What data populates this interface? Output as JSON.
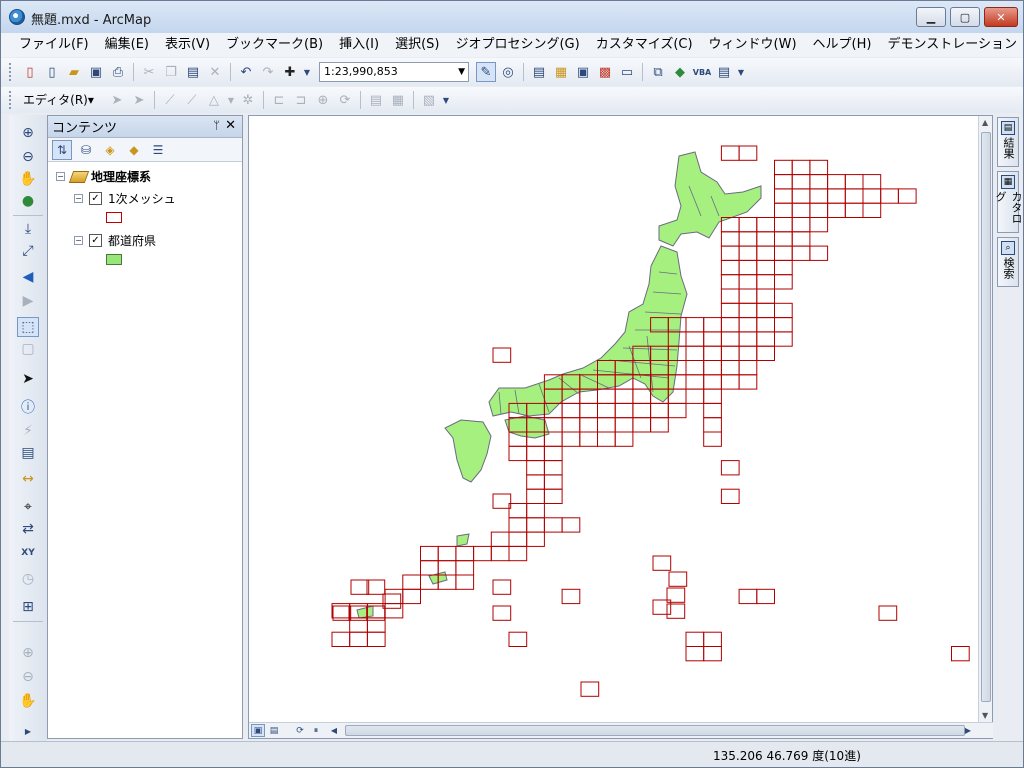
{
  "window": {
    "title": "無題.mxd - ArcMap",
    "min_label": "▁",
    "max_label": "▢",
    "close_label": "✕"
  },
  "menu": [
    {
      "label": "ファイル(F)"
    },
    {
      "label": "編集(E)"
    },
    {
      "label": "表示(V)"
    },
    {
      "label": "ブックマーク(B)"
    },
    {
      "label": "挿入(I)"
    },
    {
      "label": "選択(S)"
    },
    {
      "label": "ジオプロセシング(G)"
    },
    {
      "label": "カスタマイズ(C)"
    },
    {
      "label": "ウィンドウ(W)"
    },
    {
      "label": "ヘルプ(H)"
    },
    {
      "label": "デモンストレーション"
    }
  ],
  "toolbar": {
    "scale": "1:23,990,853",
    "editor_label": "エディタ(R)▾"
  },
  "toc": {
    "title": "コンテンツ",
    "pin": "ᛘ",
    "close": "✕",
    "root_label": "地理座標系",
    "layers": [
      {
        "label": "1次メッシュ",
        "checked": "✓",
        "swatch_fill": "#ffffff",
        "swatch_stroke": "#c00000"
      },
      {
        "label": "都道府県",
        "checked": "✓",
        "swatch_fill": "#98e67a",
        "swatch_stroke": "#4a7a3a"
      }
    ]
  },
  "map": {
    "land_color": "#a5f07f",
    "border_color": "#6b6b80",
    "mesh_color": "#b00000"
  },
  "right_dock": [
    {
      "label": "結果",
      "icon": "search-results-icon"
    },
    {
      "label": "カタログ",
      "icon": "catalog-icon"
    },
    {
      "label": "検索",
      "icon": "search-icon"
    }
  ],
  "status": {
    "coordinates": "135.206  46.769 度(10進)"
  }
}
